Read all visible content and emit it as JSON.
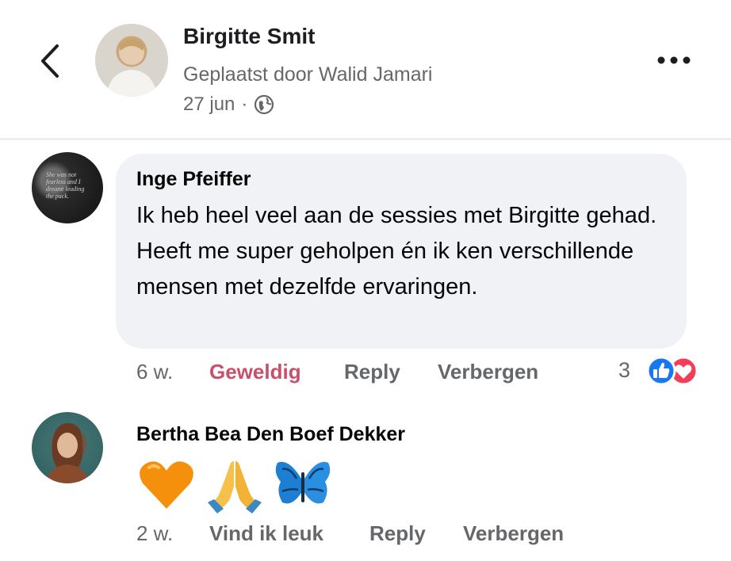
{
  "post": {
    "author": "Birgitte Smit",
    "posted_by": "Geplaatst door Walid Jamari",
    "date": "27 jun",
    "separator": "·",
    "audience_icon": "globe-icon"
  },
  "header": {
    "back_icon": "chevron-left-icon",
    "more_icon": "more-dots-icon"
  },
  "comments": [
    {
      "author": "Inge Pfeiffer",
      "text": "Ik heb heel veel aan de sessies met Birgitte gehad. Heeft me super geholpen én ik ken verschillende mensen met dezelfde ervaringen.",
      "avatar_text": "She was not fearless and I dreamt leading the pack.",
      "time": "6 w.",
      "reaction_label": "Geweldig",
      "reply_label": "Reply",
      "hide_label": "Verbergen",
      "reaction_count": "3",
      "reaction_icons": [
        "like-icon",
        "love-icon"
      ]
    },
    {
      "author": "Bertha Bea Den Boef Dekker",
      "emojis": [
        "orange-heart-icon",
        "folded-hands-icon",
        "butterfly-icon"
      ],
      "time": "2 w.",
      "like_label": "Vind ik leuk",
      "reply_label": "Reply",
      "hide_label": "Verbergen"
    }
  ],
  "colors": {
    "reaction_pink": "#c8506b",
    "secondary_text": "#65676b",
    "bubble_bg": "#f0f2f5",
    "like_blue": "#1877f2",
    "love_red": "#f33e58"
  }
}
